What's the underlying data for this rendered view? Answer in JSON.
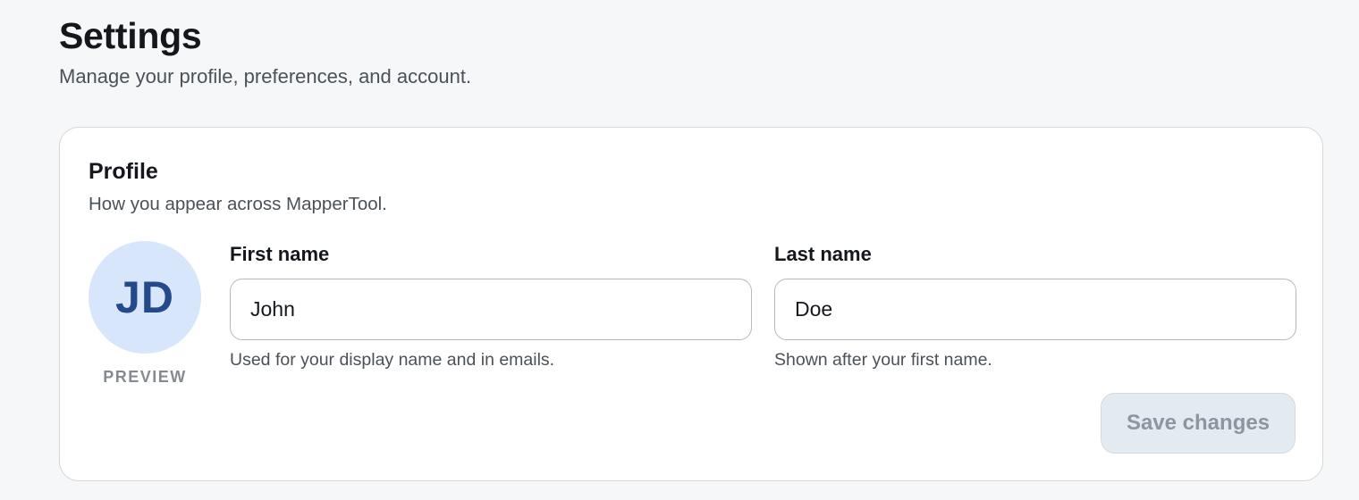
{
  "header": {
    "title": "Settings",
    "subtitle": "Manage your profile, preferences, and account."
  },
  "profile": {
    "title": "Profile",
    "subtitle": "How you appear across MapperTool.",
    "avatar": {
      "initials": "JD",
      "caption": "PREVIEW"
    },
    "first_name": {
      "label": "First name",
      "value": "John",
      "help": "Used for your display name and in emails."
    },
    "last_name": {
      "label": "Last name",
      "value": "Doe",
      "help": "Shown after your first name."
    },
    "save_label": "Save changes",
    "save_disabled": true
  },
  "colors": {
    "background": "#f5f7f8",
    "avatar_bg": "#d8e6fb",
    "avatar_text": "#234a8a",
    "button_disabled_bg": "#e4ebf0",
    "button_disabled_text": "#8c96a0"
  }
}
